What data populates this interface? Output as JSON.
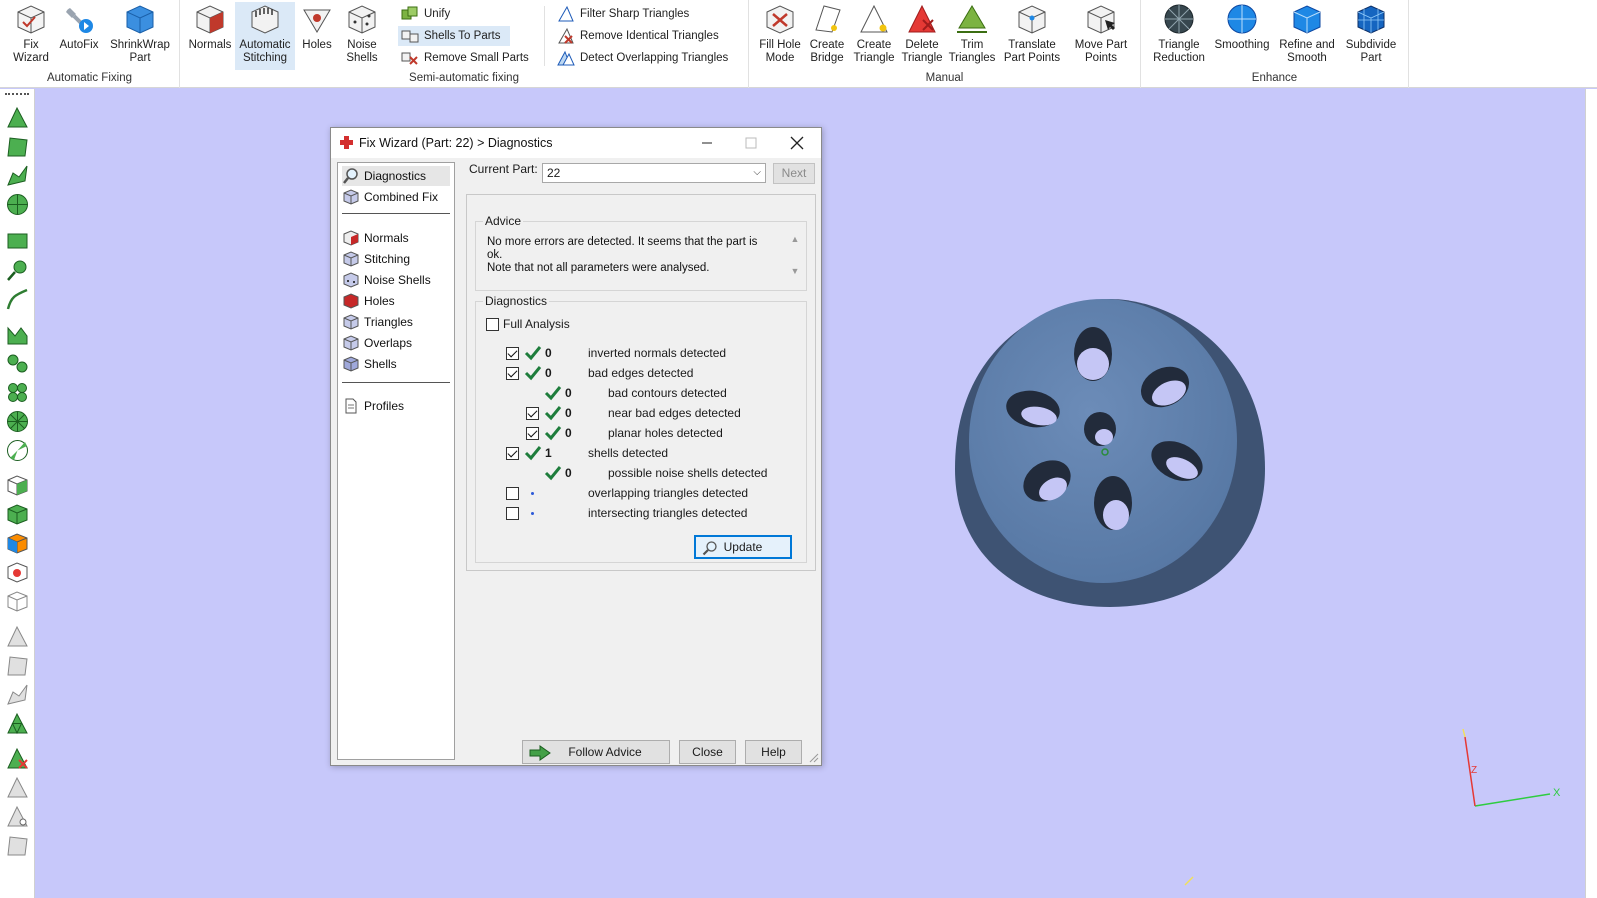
{
  "ribbon": {
    "automatic_fixing": {
      "label": "Automatic Fixing",
      "buttons": [
        "Fix\nWizard",
        "AutoFix",
        "ShrinkWrap\nPart"
      ]
    },
    "normals": "Normals",
    "automatic_stitching": "Automatic\nStitching",
    "holes": "Holes",
    "noise_shells": "Noise\nShells",
    "semi_automatic": {
      "label": "Semi-automatic fixing",
      "unify": "Unify",
      "shells_to_parts": "Shells To Parts",
      "remove_small_parts": "Remove Small Parts",
      "filter_sharp": "Filter Sharp Triangles",
      "remove_identical": "Remove Identical Triangles",
      "detect_overlapping": "Detect Overlapping Triangles"
    },
    "manual": {
      "label": "Manual",
      "buttons": [
        "Fill Hole\nMode",
        "Create\nBridge",
        "Create\nTriangle",
        "Delete\nTriangle",
        "Trim\nTriangles",
        "Translate\nPart Points",
        "Move Part\nPoints"
      ]
    },
    "enhance": {
      "label": "Enhance",
      "buttons": [
        "Triangle\nReduction",
        "Smoothing",
        "Refine and\nSmooth",
        "Subdivide\nPart"
      ]
    }
  },
  "dialog": {
    "title": "Fix Wizard (Part: 22) > Diagnostics",
    "nav": {
      "top": [
        "Diagnostics",
        "Combined Fix"
      ],
      "middle": [
        "Normals",
        "Stitching",
        "Noise Shells",
        "Holes",
        "Triangles",
        "Overlaps",
        "Shells"
      ],
      "bottom": [
        "Profiles"
      ]
    },
    "current_part_label": "Current Part:",
    "current_part_value": "22",
    "next_label": "Next",
    "advice": {
      "label": "Advice",
      "text": "No more errors are detected. It seems that the part is ok.\nNote that not all parameters were analysed."
    },
    "diagnostics": {
      "label": "Diagnostics",
      "full_analysis": "Full Analysis",
      "rows": [
        {
          "checked": true,
          "status": "ok",
          "count": "0",
          "text": "inverted normals detected"
        },
        {
          "checked": true,
          "status": "ok",
          "count": "0",
          "text": "bad edges detected"
        },
        {
          "checked": null,
          "status": "ok",
          "count": "0",
          "text": "bad contours detected"
        },
        {
          "checked": true,
          "status": "ok",
          "count": "0",
          "text": "near bad edges detected"
        },
        {
          "checked": true,
          "status": "ok",
          "count": "0",
          "text": "planar holes detected"
        },
        {
          "checked": true,
          "status": "ok",
          "count": "1",
          "text": "shells detected"
        },
        {
          "checked": null,
          "status": "ok",
          "count": "0",
          "text": "possible noise shells detected"
        },
        {
          "checked": false,
          "status": "none",
          "count": "",
          "text": "overlapping triangles detected"
        },
        {
          "checked": false,
          "status": "none",
          "count": "",
          "text": "intersecting triangles detected"
        }
      ]
    },
    "update_label": "Update",
    "follow_advice_label": "Follow Advice",
    "close_label": "Close",
    "help_label": "Help"
  },
  "axes": {
    "x": "X",
    "z": "Z"
  },
  "colors": {
    "viewport": "#c7c8fa",
    "model": "#5f7fa8",
    "check_green": "#1e7d3c",
    "accent": "#0078d7"
  }
}
